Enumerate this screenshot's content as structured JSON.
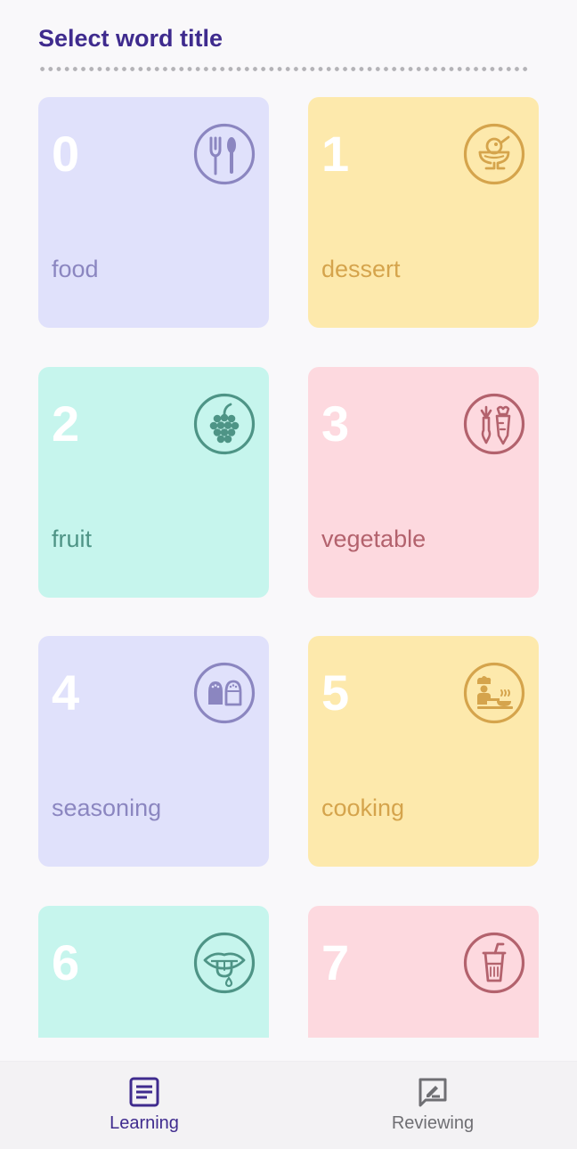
{
  "header": {
    "title": "Select word title"
  },
  "categories": [
    {
      "number": "0",
      "label": "food",
      "icon": "fork-spoon-icon",
      "bg": "#e0e1fb",
      "accent": "#8b86c0"
    },
    {
      "number": "1",
      "label": "dessert",
      "icon": "ice-cream-sundae-icon",
      "bg": "#fde9ac",
      "accent": "#d5a44c"
    },
    {
      "number": "2",
      "label": "fruit",
      "icon": "grapes-icon",
      "bg": "#c6f5ed",
      "accent": "#4e9486"
    },
    {
      "number": "3",
      "label": "vegetable",
      "icon": "carrot-radish-icon",
      "bg": "#fdd9df",
      "accent": "#b3626d"
    },
    {
      "number": "4",
      "label": "seasoning",
      "icon": "salt-pepper-shaker-icon",
      "bg": "#e0e1fb",
      "accent": "#8b86c0"
    },
    {
      "number": "5",
      "label": "cooking",
      "icon": "chef-cooking-icon",
      "bg": "#fde9ac",
      "accent": "#d5a44c"
    },
    {
      "number": "6",
      "label": "",
      "icon": "tongue-lips-icon",
      "bg": "#c6f5ed",
      "accent": "#4e9486"
    },
    {
      "number": "7",
      "label": "",
      "icon": "drink-cup-straw-icon",
      "bg": "#fdd9df",
      "accent": "#b3626d"
    }
  ],
  "bottom_nav": {
    "items": [
      {
        "label": "Learning",
        "icon": "article-icon",
        "active": true
      },
      {
        "label": "Reviewing",
        "icon": "rate-review-icon",
        "active": false
      }
    ]
  },
  "colors": {
    "title": "#3f2b8e",
    "nav_active": "#3f2b8e",
    "nav_inactive": "#6f6f73",
    "background": "#f9f8fa"
  }
}
